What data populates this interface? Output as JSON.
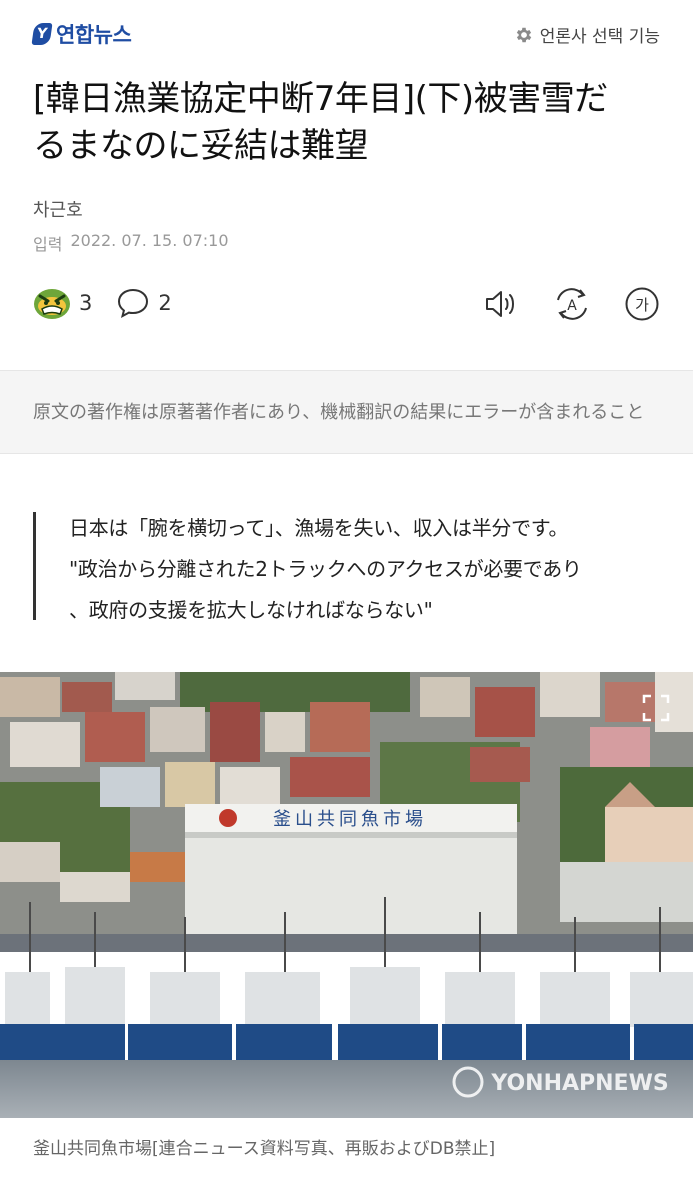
{
  "header": {
    "logo_text": "연합뉴스",
    "logo_mark": "Y",
    "press_select_label": "언론사 선택 기능",
    "press_select_icon": "gear-icon"
  },
  "article": {
    "title_line1": "[韓日漁業協定中断7年目](下)被害雪だ",
    "title_line2": "るまなのに妥結は難望",
    "author": "차근호",
    "date_label": "입력",
    "date_value": "2022. 07. 15. 07:10"
  },
  "reactions": {
    "emoji_count": "3",
    "comment_count": "2"
  },
  "tools": [
    {
      "name": "listen-icon"
    },
    {
      "name": "translate-icon",
      "glyph": "A"
    },
    {
      "name": "font-size-icon",
      "glyph": "가"
    }
  ],
  "notice": {
    "text": "原文の著作権は原著著作者にあり、機械翻訳の結果にエラーが含まれること"
  },
  "quote": {
    "line1": "日本は「腕を横切って」、漁場を失い、収入は半分です。",
    "line2": "\"政治から分離された2トラックへのアクセスが必要であり",
    "line3": "、政府の支援を拡大しなければならない\""
  },
  "photo": {
    "building_sign": "釜山共同魚市場",
    "watermark": "YONHAPNEWS",
    "caption": "釜山共同魚市場[連合ニュース資料写真、再販およびDB禁止]"
  },
  "colors": {
    "brand": "#1f4da3",
    "notice_bg": "#f5f5f5",
    "text_gray": "#999999"
  }
}
